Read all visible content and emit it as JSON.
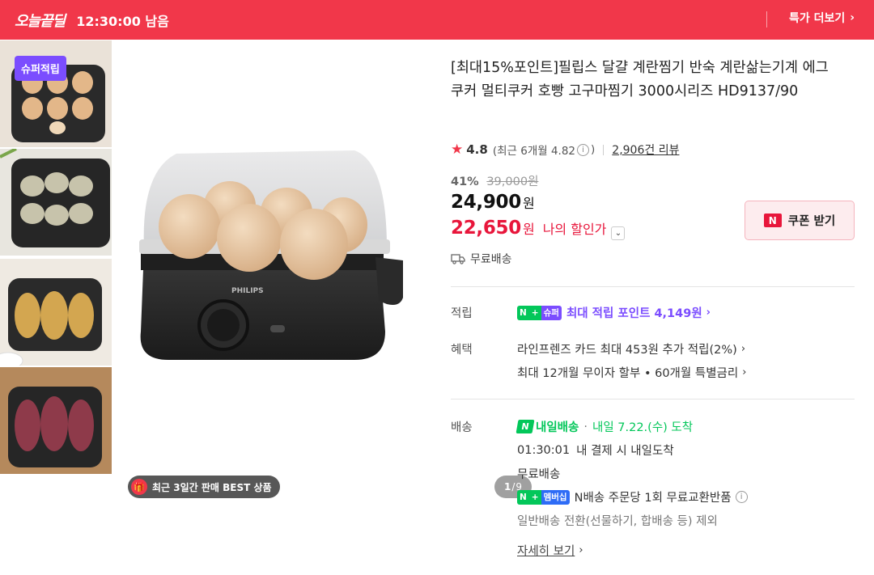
{
  "banner": {
    "logo": "오늘끝딜",
    "countdown": "12:30:00 남음",
    "more_label": "특가 더보기"
  },
  "thumbnails": {
    "super_badge": "슈퍼적립",
    "items": [
      "eggs",
      "dumplings",
      "potatoes",
      "sweet-potatoes"
    ]
  },
  "main_image": {
    "brand_text": "PHILIPS",
    "best_tag": "최근 3일간 판매 BEST 상품",
    "counter_current": "1",
    "counter_total": "9"
  },
  "product": {
    "title": "[최대15%포인트]필립스 달걀 계란찜기 반숙 계란삶는기계 에그쿠커 멀티쿠커 호빵 고구마찜기 3000시리즈 HD9137/90",
    "rating": "4.8",
    "rating_recent": "(최근 6개월 4.82",
    "rating_recent_close": ")",
    "review_count": "2,906건 리뷰",
    "discount_pct": "41%",
    "original_price": "39,000원",
    "price": "24,900",
    "won": "원",
    "my_price": "22,650",
    "my_price_label": "나의 할인가",
    "coupon_label": "쿠폰 받기",
    "coupon_badge": "N",
    "free_shipping": "무료배송"
  },
  "points": {
    "label": "적립",
    "chip_n": "N",
    "chip_plus": "+",
    "chip_super": "슈퍼",
    "text": "최대 적립 포인트 4,149원"
  },
  "benefits": {
    "label": "혜택",
    "line1": "라인프렌즈 카드 최대 453원 추가 적립(2%)",
    "line2": "최대 12개월 무이자 할부 • 60개월 특별금리"
  },
  "delivery": {
    "label": "배송",
    "nextday_badge": "N",
    "nextday_label": "내일배송",
    "arrival": "내일 7.22.(수) 도착",
    "cutoff_time": "01:30:01",
    "cutoff_text": "내 결제 시 내일도착",
    "free": "무료배송",
    "member_chip": "멤버십",
    "exchange": "N배송 주문당 1회 무료교환반품",
    "exclusion": "일반배송 전환(선물하기, 합배송 등) 제외",
    "detail_link": "자세히 보기"
  },
  "colors": {
    "banner": "#f1374a",
    "sale_red": "#e8163b",
    "naver_green": "#03c75a",
    "super_purple": "#7b4dff"
  }
}
